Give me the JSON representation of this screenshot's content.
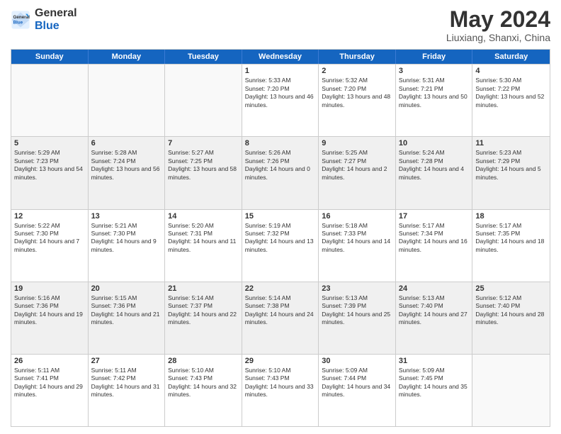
{
  "header": {
    "logo_general": "General",
    "logo_blue": "Blue",
    "month": "May 2024",
    "location": "Liuxiang, Shanxi, China"
  },
  "days_of_week": [
    "Sunday",
    "Monday",
    "Tuesday",
    "Wednesday",
    "Thursday",
    "Friday",
    "Saturday"
  ],
  "weeks": [
    [
      {
        "day": "",
        "empty": true
      },
      {
        "day": "",
        "empty": true
      },
      {
        "day": "",
        "empty": true
      },
      {
        "day": "1",
        "sunrise": "5:33 AM",
        "sunset": "7:20 PM",
        "daylight": "13 hours and 46 minutes."
      },
      {
        "day": "2",
        "sunrise": "5:32 AM",
        "sunset": "7:20 PM",
        "daylight": "13 hours and 48 minutes."
      },
      {
        "day": "3",
        "sunrise": "5:31 AM",
        "sunset": "7:21 PM",
        "daylight": "13 hours and 50 minutes."
      },
      {
        "day": "4",
        "sunrise": "5:30 AM",
        "sunset": "7:22 PM",
        "daylight": "13 hours and 52 minutes."
      }
    ],
    [
      {
        "day": "5",
        "sunrise": "5:29 AM",
        "sunset": "7:23 PM",
        "daylight": "13 hours and 54 minutes."
      },
      {
        "day": "6",
        "sunrise": "5:28 AM",
        "sunset": "7:24 PM",
        "daylight": "13 hours and 56 minutes."
      },
      {
        "day": "7",
        "sunrise": "5:27 AM",
        "sunset": "7:25 PM",
        "daylight": "13 hours and 58 minutes."
      },
      {
        "day": "8",
        "sunrise": "5:26 AM",
        "sunset": "7:26 PM",
        "daylight": "14 hours and 0 minutes."
      },
      {
        "day": "9",
        "sunrise": "5:25 AM",
        "sunset": "7:27 PM",
        "daylight": "14 hours and 2 minutes."
      },
      {
        "day": "10",
        "sunrise": "5:24 AM",
        "sunset": "7:28 PM",
        "daylight": "14 hours and 4 minutes."
      },
      {
        "day": "11",
        "sunrise": "5:23 AM",
        "sunset": "7:29 PM",
        "daylight": "14 hours and 5 minutes."
      }
    ],
    [
      {
        "day": "12",
        "sunrise": "5:22 AM",
        "sunset": "7:30 PM",
        "daylight": "14 hours and 7 minutes."
      },
      {
        "day": "13",
        "sunrise": "5:21 AM",
        "sunset": "7:30 PM",
        "daylight": "14 hours and 9 minutes."
      },
      {
        "day": "14",
        "sunrise": "5:20 AM",
        "sunset": "7:31 PM",
        "daylight": "14 hours and 11 minutes."
      },
      {
        "day": "15",
        "sunrise": "5:19 AM",
        "sunset": "7:32 PM",
        "daylight": "14 hours and 13 minutes."
      },
      {
        "day": "16",
        "sunrise": "5:18 AM",
        "sunset": "7:33 PM",
        "daylight": "14 hours and 14 minutes."
      },
      {
        "day": "17",
        "sunrise": "5:17 AM",
        "sunset": "7:34 PM",
        "daylight": "14 hours and 16 minutes."
      },
      {
        "day": "18",
        "sunrise": "5:17 AM",
        "sunset": "7:35 PM",
        "daylight": "14 hours and 18 minutes."
      }
    ],
    [
      {
        "day": "19",
        "sunrise": "5:16 AM",
        "sunset": "7:36 PM",
        "daylight": "14 hours and 19 minutes."
      },
      {
        "day": "20",
        "sunrise": "5:15 AM",
        "sunset": "7:36 PM",
        "daylight": "14 hours and 21 minutes."
      },
      {
        "day": "21",
        "sunrise": "5:14 AM",
        "sunset": "7:37 PM",
        "daylight": "14 hours and 22 minutes."
      },
      {
        "day": "22",
        "sunrise": "5:14 AM",
        "sunset": "7:38 PM",
        "daylight": "14 hours and 24 minutes."
      },
      {
        "day": "23",
        "sunrise": "5:13 AM",
        "sunset": "7:39 PM",
        "daylight": "14 hours and 25 minutes."
      },
      {
        "day": "24",
        "sunrise": "5:13 AM",
        "sunset": "7:40 PM",
        "daylight": "14 hours and 27 minutes."
      },
      {
        "day": "25",
        "sunrise": "5:12 AM",
        "sunset": "7:40 PM",
        "daylight": "14 hours and 28 minutes."
      }
    ],
    [
      {
        "day": "26",
        "sunrise": "5:11 AM",
        "sunset": "7:41 PM",
        "daylight": "14 hours and 29 minutes."
      },
      {
        "day": "27",
        "sunrise": "5:11 AM",
        "sunset": "7:42 PM",
        "daylight": "14 hours and 31 minutes."
      },
      {
        "day": "28",
        "sunrise": "5:10 AM",
        "sunset": "7:43 PM",
        "daylight": "14 hours and 32 minutes."
      },
      {
        "day": "29",
        "sunrise": "5:10 AM",
        "sunset": "7:43 PM",
        "daylight": "14 hours and 33 minutes."
      },
      {
        "day": "30",
        "sunrise": "5:09 AM",
        "sunset": "7:44 PM",
        "daylight": "14 hours and 34 minutes."
      },
      {
        "day": "31",
        "sunrise": "5:09 AM",
        "sunset": "7:45 PM",
        "daylight": "14 hours and 35 minutes."
      },
      {
        "day": "",
        "empty": true
      }
    ]
  ]
}
